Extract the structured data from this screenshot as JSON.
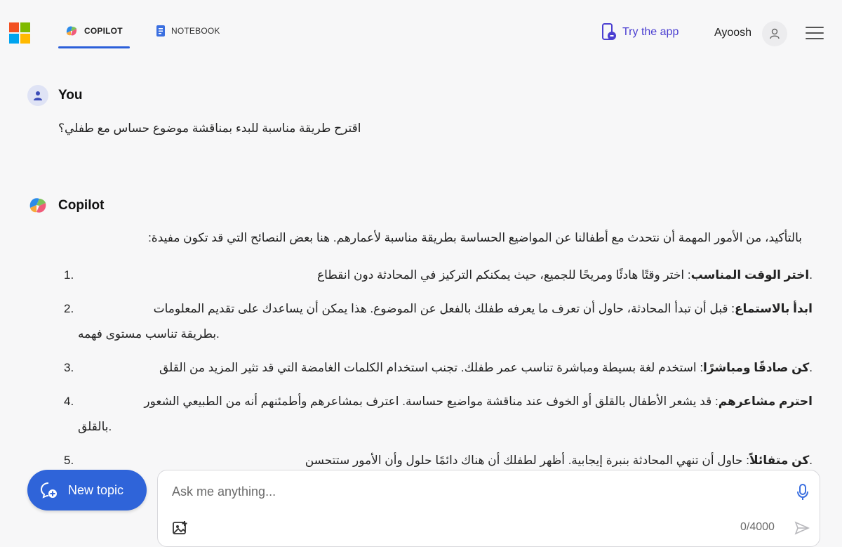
{
  "header": {
    "tabs": [
      {
        "label": "COPILOT",
        "active": true
      },
      {
        "label": "NOTEBOOK",
        "active": false
      }
    ],
    "try_app": "Try the app",
    "user_name": "Ayoosh"
  },
  "conversation": {
    "user": {
      "name": "You",
      "message": "اقترح طريقة مناسبة للبدء بمناقشة موضوع حساس مع طفلي؟"
    },
    "copilot": {
      "name": "Copilot",
      "intro": ":بالتأكيد، من الأمور المهمة أن نتحدث مع أطفالنا عن المواضيع الحساسة بطريقة مناسبة لأعمارهم. هنا بعض النصائح التي قد تكون مفيدة",
      "items": [
        {
          "num": "1.",
          "title": "اختر الوقت المناسب",
          "text": ": اختر وقتًا هادئًا ومريحًا للجميع، حيث يمكنكم التركيز في المحادثة دون انقطاع.",
          "cont": ""
        },
        {
          "num": "2.",
          "title": "ابدأ بالاستماع",
          "text": ": قبل أن تبدأ المحادثة، حاول أن تعرف ما يعرفه طفلك بالفعل عن الموضوع. هذا يمكن أن يساعدك على تقديم المعلومات",
          "cont": "بطريقة تناسب مستوى فهمه."
        },
        {
          "num": "3.",
          "title": "كن صادقًا ومباشرًا",
          "text": ": استخدم لغة بسيطة ومباشرة تناسب عمر طفلك. تجنب استخدام الكلمات الغامضة التي قد تثير المزيد من القلق.",
          "cont": ""
        },
        {
          "num": "4.",
          "title": "احترم مشاعرهم",
          "text": ": قد يشعر الأطفال بالقلق أو الخوف عند مناقشة مواضيع حساسة. اعترف بمشاعرهم وأطمئنهم أنه من الطبيعي الشعور",
          "cont": "بالقلق."
        },
        {
          "num": "5.",
          "title": "كن متفائلاً",
          "text": ": حاول أن تنهي المحادثة بنبرة إيجابية. أظهر لطفلك أن هناك دائمًا حلول وأن الأمور ستتحسن.",
          "cont": ""
        }
      ]
    }
  },
  "composer": {
    "new_topic": "New topic",
    "placeholder": "Ask me anything...",
    "counter": "0/4000"
  },
  "colors": {
    "accent": "#2f64d9",
    "try_app": "#4b3fd1"
  }
}
